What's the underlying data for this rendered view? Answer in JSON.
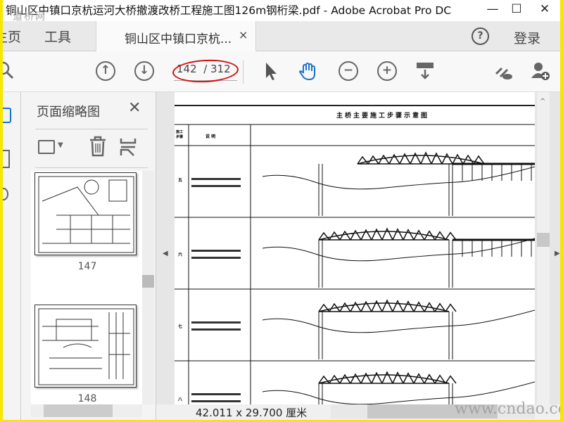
{
  "window": {
    "title": "铜山区中镇口京杭运河大桥撤渡改桥工程施工图126m钢桁梁.pdf - Adobe Acrobat Pro DC",
    "watermark_top": "道桥网",
    "minimize": "—",
    "maximize": "☐",
    "close": "✕"
  },
  "tabs": {
    "home": "主页",
    "tools": "工具",
    "document": "铜山区中镇口京杭...",
    "close": "×",
    "help": "?",
    "login": "登录"
  },
  "toolbar": {
    "current_page": "142",
    "total_pages": "/ 312"
  },
  "panel": {
    "title": "页面缩略图",
    "close": "✕",
    "thumbnails": [
      {
        "label": "147"
      },
      {
        "label": "148"
      }
    ]
  },
  "document": {
    "heading": "主桥主要施工步骤示意图",
    "col_step": "施工步骤",
    "col_desc": "说 明",
    "rows": [
      {
        "step": "五"
      },
      {
        "step": "六"
      },
      {
        "step": "七"
      },
      {
        "step": "八"
      }
    ]
  },
  "status": {
    "dimensions": "42.011 x 29.700 厘米",
    "watermark": "www.cndao.com"
  },
  "colors": {
    "accent": "#1a73c8",
    "highlight_ellipse": "#d41010",
    "frame": "#f7e600"
  }
}
